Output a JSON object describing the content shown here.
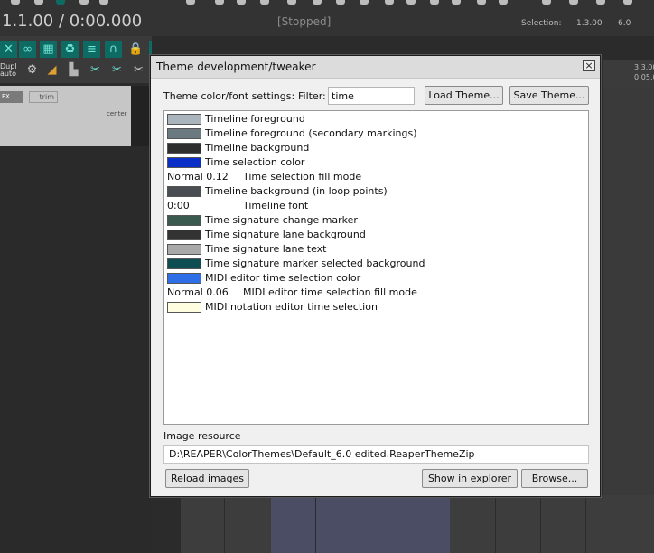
{
  "reaper": {
    "timecode": "1.1.00 / 0:00.000",
    "transport_status": "[Stopped]",
    "selection_label": "Selection:",
    "selection_start": "1.3.00",
    "selection_end": "6.0",
    "ruler_marks": [
      "3.3.00",
      "0:05.0"
    ],
    "track_fx_label": "FX",
    "track_trim_label": "trim",
    "track_pan_label": "center",
    "dupl_label": "Dupl",
    "auto_label": "auto"
  },
  "dialog": {
    "title": "Theme development/tweaker",
    "close_glyph": "×",
    "settings_label": "Theme color/font settings:",
    "filter_label": "Filter:",
    "filter_value": "time",
    "load_theme_label": "Load Theme...",
    "save_theme_label": "Save Theme...",
    "items": [
      {
        "kind": "color",
        "color": "#aab4bc",
        "label": "Timeline foreground"
      },
      {
        "kind": "color",
        "color": "#6b7a80",
        "label": "Timeline foreground (secondary markings)"
      },
      {
        "kind": "color",
        "color": "#2e2e2e",
        "label": "Timeline background"
      },
      {
        "kind": "color",
        "color": "#0a2fc8",
        "label": "Time selection color"
      },
      {
        "kind": "value",
        "value": "Normal 0.12",
        "label": "Time selection fill mode"
      },
      {
        "kind": "color",
        "color": "#4a4e52",
        "label": "Timeline background (in loop points)"
      },
      {
        "kind": "value",
        "value": "0:00",
        "label": "Timeline font"
      },
      {
        "kind": "color",
        "color": "#3a5a50",
        "label": "Time signature change marker"
      },
      {
        "kind": "color",
        "color": "#333333",
        "label": "Time signature lane background"
      },
      {
        "kind": "color",
        "color": "#a8a8a8",
        "label": "Time signature lane text"
      },
      {
        "kind": "color",
        "color": "#0e4d52",
        "label": "Time signature marker selected background"
      },
      {
        "kind": "color",
        "color": "#2e6fe8",
        "label": "MIDI editor time selection color"
      },
      {
        "kind": "value",
        "value": "Normal 0.06",
        "label": "MIDI editor time selection fill mode"
      },
      {
        "kind": "color",
        "color": "#fffde0",
        "label": "MIDI notation editor time selection"
      }
    ],
    "image_resource_label": "Image resource",
    "image_resource_path": "D:\\REAPER\\ColorThemes\\Default_6.0 edited.ReaperThemeZip",
    "reload_images_label": "Reload images",
    "show_in_explorer_label": "Show in explorer",
    "browse_label": "Browse..."
  }
}
